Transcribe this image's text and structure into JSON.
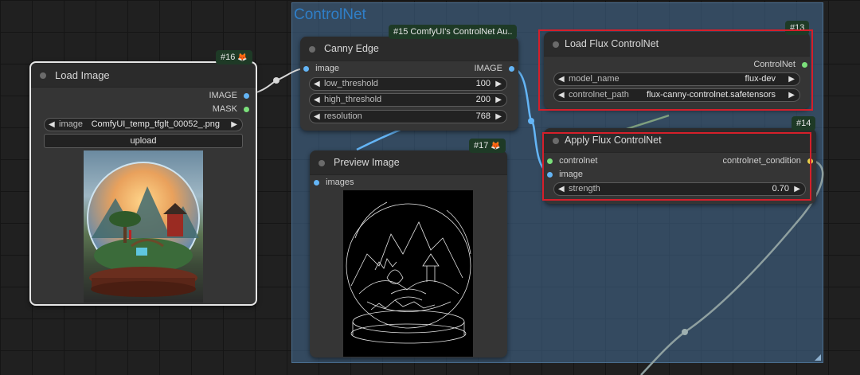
{
  "group": {
    "title": "ControlNet"
  },
  "nodes": {
    "load_image": {
      "badge": "#16",
      "title": "Load Image",
      "outputs": [
        "IMAGE",
        "MASK"
      ],
      "widget_name": "image",
      "widget_value": "ComfyUI_temp_tfglt_00052_.png",
      "upload_label": "upload"
    },
    "canny": {
      "badge": "#15 ComfyUI's ControlNet Au..",
      "title": "Canny Edge",
      "input": "image",
      "output": "IMAGE",
      "widgets": [
        {
          "name": "low_threshold",
          "value": "100"
        },
        {
          "name": "high_threshold",
          "value": "200"
        },
        {
          "name": "resolution",
          "value": "768"
        }
      ]
    },
    "preview": {
      "badge": "#17",
      "title": "Preview Image",
      "input": "images"
    },
    "load_flux": {
      "badge": "#13",
      "title": "Load Flux ControlNet",
      "output": "ControlNet",
      "widgets": [
        {
          "name": "model_name",
          "value": "flux-dev"
        },
        {
          "name": "controlnet_path",
          "value": "flux-canny-controlnet.safetensors"
        }
      ]
    },
    "apply_flux": {
      "badge": "#14",
      "title": "Apply Flux ControlNet",
      "inputs": [
        "controlnet",
        "image"
      ],
      "output": "controlnet_condition",
      "widgets": [
        {
          "name": "strength",
          "value": "0.70"
        }
      ]
    }
  },
  "icons": {
    "fox": "fox-icon",
    "left_arrow": "left-arrow-icon",
    "right_arrow": "right-arrow-icon"
  },
  "colors": {
    "highlight": "#d51f2a",
    "image_link": "#64b5f6",
    "controlnet_link": "#7be07b",
    "condition_link": "#e8d14a"
  }
}
